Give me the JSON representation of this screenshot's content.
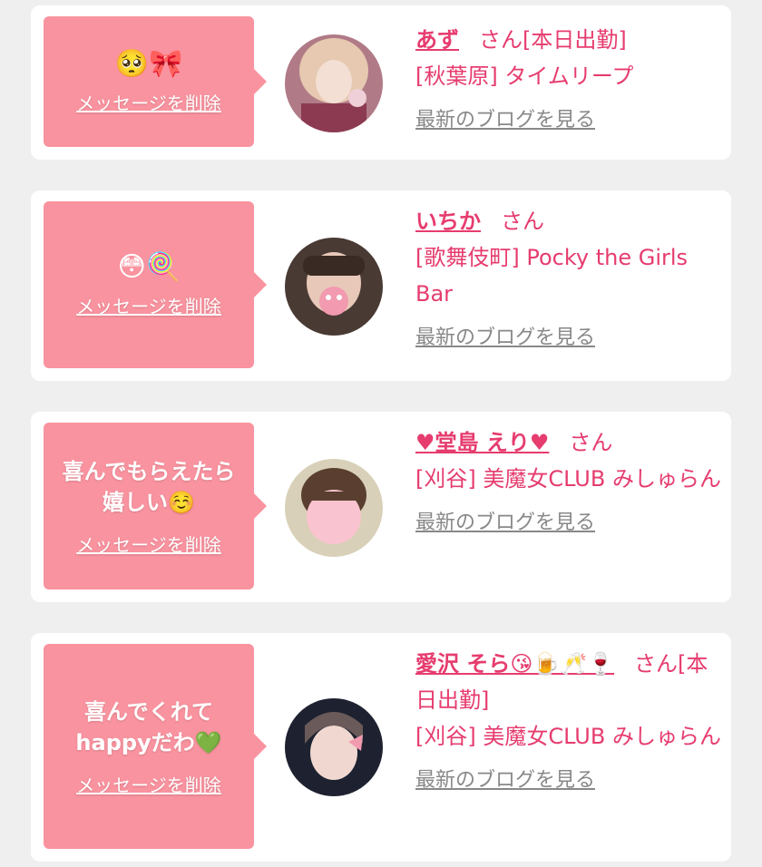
{
  "cards": [
    {
      "message": "",
      "emoji": "🥺🎀",
      "delete_label": "メッセージを削除",
      "name": "あず",
      "honorific": "さん",
      "status": "[本日出勤]",
      "area_shop": "[秋葉原] タイムリープ",
      "blog_label": "最新のブログを見る"
    },
    {
      "message": "",
      "emoji": "😳🍭",
      "delete_label": "メッセージを削除",
      "name": "いちか",
      "honorific": "さん",
      "status": "",
      "area_shop": "[歌舞伎町] Pocky the Girls Bar",
      "blog_label": "最新のブログを見る"
    },
    {
      "message": "喜んでもらえたら嬉しい☺️",
      "emoji": "",
      "delete_label": "メッセージを削除",
      "name": "♥堂島 えり♥",
      "honorific": "さん",
      "status": "",
      "area_shop": "[刈谷] 美魔女CLUB みしゅらん",
      "blog_label": "最新のブログを見る"
    },
    {
      "message": "喜んでくれてhappyだわ💚",
      "emoji": "",
      "delete_label": "メッセージを削除",
      "name": "愛沢 そら😘🍺🥂🍷",
      "honorific": "さん",
      "status": "[本日出勤]",
      "area_shop": "[刈谷] 美魔女CLUB みしゅらん",
      "blog_label": "最新のブログを見る"
    }
  ]
}
